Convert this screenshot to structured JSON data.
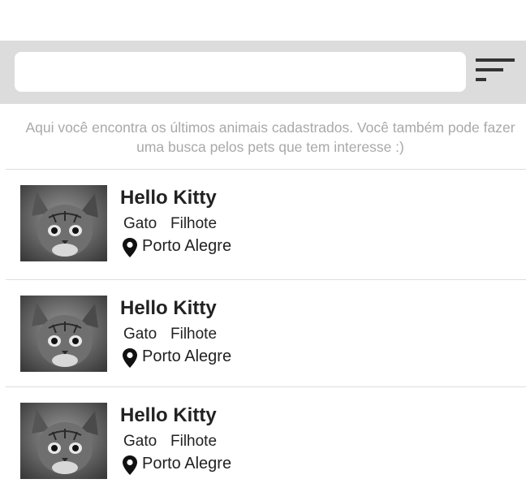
{
  "search": {
    "value": "",
    "placeholder": ""
  },
  "filter": {
    "icon": "filter-lines-icon"
  },
  "intro_text": "Aqui você encontra os últimos animais cadastrados. Você também pode fazer uma busca pelos pets que tem interesse :)",
  "pets": [
    {
      "name": "Hello Kitty",
      "species": "Gato",
      "age": "Filhote",
      "location": "Porto Alegre",
      "photo": "kitten-photo",
      "location_icon": "map-pin-icon"
    },
    {
      "name": "Hello Kitty",
      "species": "Gato",
      "age": "Filhote",
      "location": "Porto Alegre",
      "photo": "kitten-photo",
      "location_icon": "map-pin-icon"
    },
    {
      "name": "Hello Kitty",
      "species": "Gato",
      "age": "Filhote",
      "location": "Porto Alegre",
      "photo": "kitten-photo",
      "location_icon": "map-pin-icon"
    }
  ],
  "colors": {
    "search_bar_bg": "#dcdcdc",
    "intro_text": "#a9a9a9",
    "text": "#222222",
    "divider": "#dddddd"
  }
}
